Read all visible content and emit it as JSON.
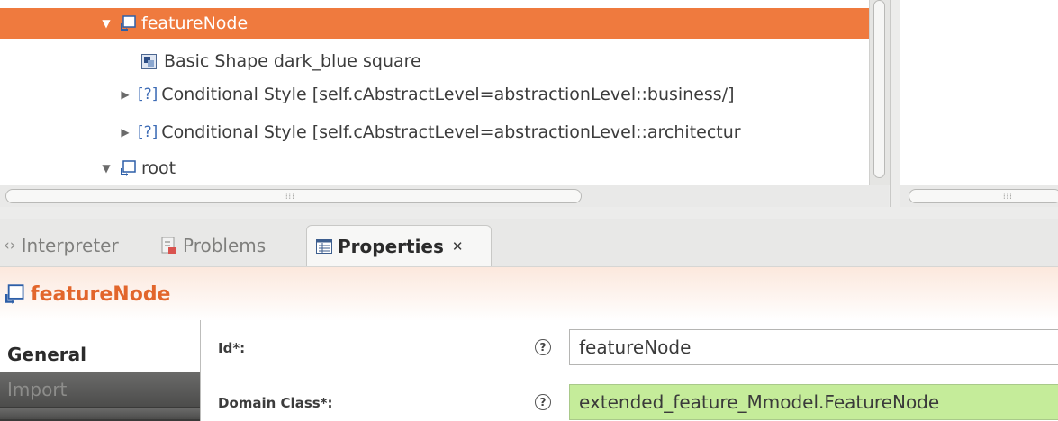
{
  "tree": {
    "items": [
      {
        "label": "featureNode",
        "icon": "node-icon",
        "expanded": true,
        "selected": true
      },
      {
        "label": "Basic Shape dark_blue square",
        "icon": "shape-icon"
      },
      {
        "label": "Conditional Style [self.cAbstractLevel=abstractionLevel::business/]",
        "prefix": "[?]",
        "expanded": false
      },
      {
        "label": "Conditional Style [self.cAbstractLevel=abstractionLevel::architectur",
        "prefix": "[?]",
        "expanded": false
      },
      {
        "label": "root",
        "icon": "node-icon",
        "expanded": true
      }
    ]
  },
  "tabs": [
    {
      "label": "Interpreter",
      "icon": "code-brackets-icon"
    },
    {
      "label": "Problems",
      "icon": "problems-icon"
    },
    {
      "label": "Properties",
      "icon": "properties-icon",
      "active": true
    }
  ],
  "properties": {
    "title": "featureNode",
    "side_tabs": [
      "General",
      "Import"
    ],
    "fields": [
      {
        "label": "Id*:",
        "value": "featureNode"
      },
      {
        "label": "Domain Class*:",
        "value": "extended_feature_Mmodel.FeatureNode"
      }
    ]
  },
  "colors": {
    "selection": "#ef7a3e",
    "title_accent": "#e2662c",
    "valid_field": "#c5ec9a"
  }
}
